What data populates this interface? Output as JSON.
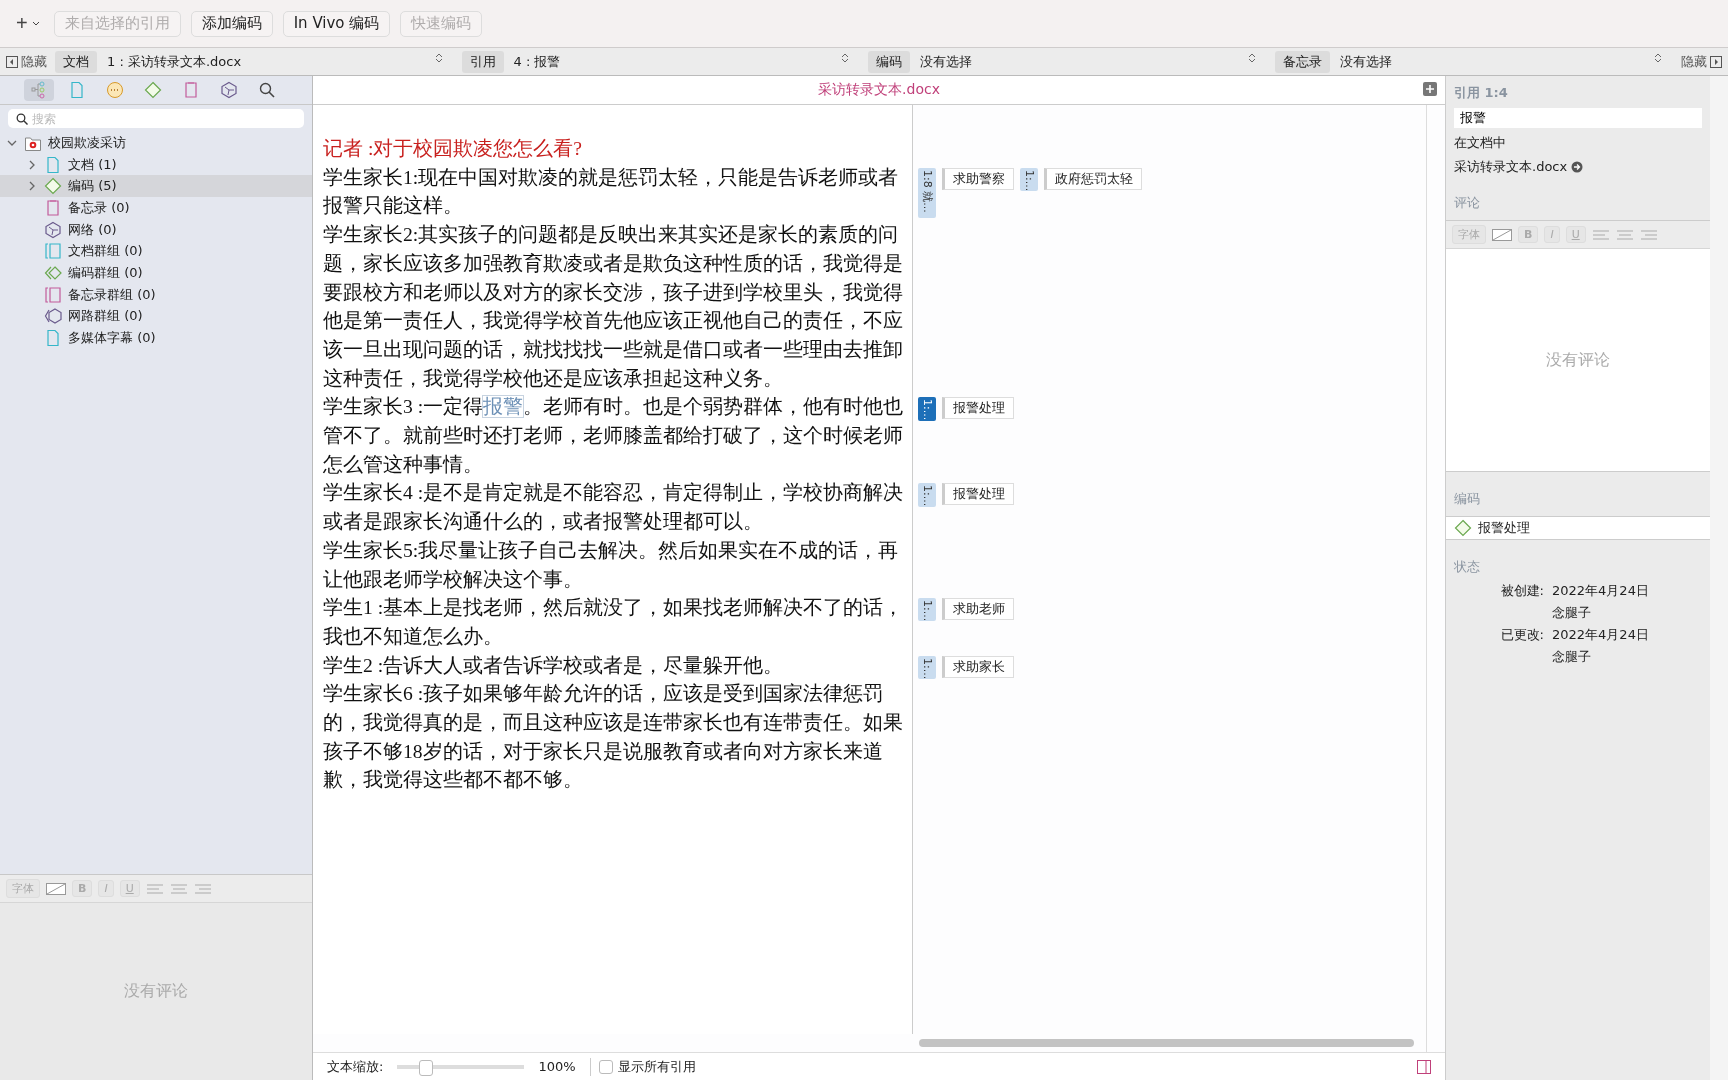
{
  "toolbar": {
    "add_menu": "+",
    "buttons": [
      {
        "label": "来自选择的引用",
        "disabled": true
      },
      {
        "label": "添加编码",
        "disabled": false
      },
      {
        "label": "In Vivo 编码",
        "disabled": false
      },
      {
        "label": "快速编码",
        "disabled": true
      }
    ]
  },
  "selector_bar": {
    "hide_left": "隐藏",
    "hide_right": "隐藏",
    "selectors": [
      {
        "label": "文档",
        "value": "1 : 采访转录文本.docx"
      },
      {
        "label": "引用",
        "value": "4 : 报警"
      },
      {
        "label": "编码",
        "value": "没有选择"
      },
      {
        "label": "备忘录",
        "value": "没有选择"
      }
    ]
  },
  "navigator": {
    "tabs": [
      {
        "kind": "tree",
        "selected": true
      },
      {
        "kind": "documents",
        "selected": false
      },
      {
        "kind": "quotations",
        "selected": false
      },
      {
        "kind": "codes",
        "selected": false
      },
      {
        "kind": "memos",
        "selected": false
      },
      {
        "kind": "networks",
        "selected": false
      },
      {
        "kind": "search",
        "selected": false
      }
    ],
    "search": {
      "placeholder": "搜索"
    },
    "tree": [
      {
        "label": "校园欺凌采访",
        "kind": "project",
        "expanded": true,
        "selected": false,
        "children": [
          {
            "label": "文档 (1)",
            "kind": "documents",
            "expanded": false,
            "selected": false
          },
          {
            "label": "编码 (5)",
            "kind": "codes",
            "expanded": false,
            "selected": true
          },
          {
            "label": "备忘录 (0)",
            "kind": "memos",
            "selected": false
          },
          {
            "label": "网络 (0)",
            "kind": "networks",
            "selected": false
          },
          {
            "label": "文档群组 (0)",
            "kind": "document_groups",
            "selected": false
          },
          {
            "label": "编码群组 (0)",
            "kind": "code_groups",
            "selected": false
          },
          {
            "label": "备忘录群组 (0)",
            "kind": "memo_groups",
            "selected": false
          },
          {
            "label": "网路群组 (0)",
            "kind": "network_groups",
            "selected": false
          },
          {
            "label": "多媒体字幕 (0)",
            "kind": "documents",
            "selected": false
          }
        ]
      }
    ],
    "comment": {
      "format": {
        "font": "字体",
        "styles": [
          "B",
          "I",
          "U"
        ]
      },
      "empty": "没有评论"
    }
  },
  "document": {
    "title": "采访转录文本.docx",
    "paragraphs": [
      {
        "kind": "question",
        "segments": [
          {
            "text": "记者 :对于校园欺凌您怎么看?",
            "highlighted": false
          }
        ]
      },
      {
        "kind": "answer",
        "segments": [
          {
            "text": "学生家长1:现在中国对欺凌的就是惩罚太轻，只能是告诉老师或者报警只能这样。",
            "highlighted": false
          }
        ],
        "codings": [
          {
            "marker": "1:8 就...",
            "label": "求助警察",
            "selected": false
          },
          {
            "marker": "1:...",
            "label": "政府惩罚太轻",
            "selected": false
          }
        ]
      },
      {
        "kind": "answer",
        "segments": [
          {
            "text": "学生家长2:其实孩子的问题都是反映出来其实还是家长的素质的问题，家长应该多加强教育欺凌或者是欺负这种性质的话，我觉得是要跟校方和老师以及对方的家长交涉，孩子进到学校里头，我觉得他是第一责任人，我觉得学校首先他应该正视他自己的责任，不应该一旦出现问题的话，就找找找一些就是借口或者一些理由去推卸这种责任，我觉得学校他还是应该承担起这种义务。",
            "highlighted": false
          }
        ]
      },
      {
        "kind": "answer",
        "segments": [
          {
            "text": "学生家长3 :一定得",
            "highlighted": false
          },
          {
            "text": "报警",
            "highlighted": true
          },
          {
            "text": "。老师有时。也是个弱势群体，他有时他也管不了。就前些时还打老师，老师膝盖都给打破了，这个时候老师怎么管这种事情。",
            "highlighted": false
          }
        ],
        "codings": [
          {
            "marker": "1:...",
            "label": "报警处理",
            "selected": true
          }
        ]
      },
      {
        "kind": "answer",
        "segments": [
          {
            "text": "学生家长4 :是不是肯定就是不能容忍，肯定得制止，学校协商解决或者是跟家长沟通什么的，或者报警处理都可以。",
            "highlighted": false
          }
        ],
        "codings": [
          {
            "marker": "1:...",
            "label": "报警处理",
            "selected": false
          }
        ]
      },
      {
        "kind": "answer",
        "segments": [
          {
            "text": "学生家长5:我尽量让孩子自己去解决。然后如果实在不成的话，再让他跟老师学校解决这个事。",
            "highlighted": false
          }
        ]
      },
      {
        "kind": "answer",
        "segments": [
          {
            "text": "学生1 :基本上是找老师，然后就没了，如果找老师解决不了的话，我也不知道怎么办。",
            "highlighted": false
          }
        ],
        "codings": [
          {
            "marker": "1:...",
            "label": "求助老师",
            "selected": false
          }
        ]
      },
      {
        "kind": "answer",
        "segments": [
          {
            "text": "学生2 :告诉大人或者告诉学校或者是，尽量躲开他。",
            "highlighted": false
          }
        ],
        "codings": [
          {
            "marker": "1:...",
            "label": "求助家长",
            "selected": false
          }
        ]
      },
      {
        "kind": "answer",
        "segments": [
          {
            "text": "学生家长6 :孩子如果够年龄允许的话，应该是受到国家法律惩罚的，我觉得真的是，而且这种应该是连带家长也有连带责任。如果孩子不够18岁的话，对于家长只是说服教育或者向对方家长来道歉，我觉得这些都不都不够。",
            "highlighted": false
          }
        ]
      }
    ],
    "status_bar": {
      "zoom_label": "文本缩放:",
      "zoom": {
        "level": 0.22
      },
      "zoom_value": "100%",
      "show_all": {
        "label": "显示所有引用",
        "checked": false
      }
    }
  },
  "inspector": {
    "header": "引用 1:4",
    "name": "报警",
    "in_document_label": "在文档中",
    "document_link": "采访转录文本.docx",
    "comment_heading": "评论",
    "format": {
      "font": "字体",
      "styles": [
        "B",
        "I",
        "U"
      ]
    },
    "comment_empty": "没有评论",
    "codes_heading": "编码",
    "codes": [
      "报警处理"
    ],
    "status_heading": "状态",
    "status": [
      {
        "label": "被创建:",
        "date": "2022年4月24日",
        "user": "念腿子"
      },
      {
        "label": "已更改:",
        "date": "2022年4月24日",
        "user": "念腿子"
      }
    ]
  }
}
